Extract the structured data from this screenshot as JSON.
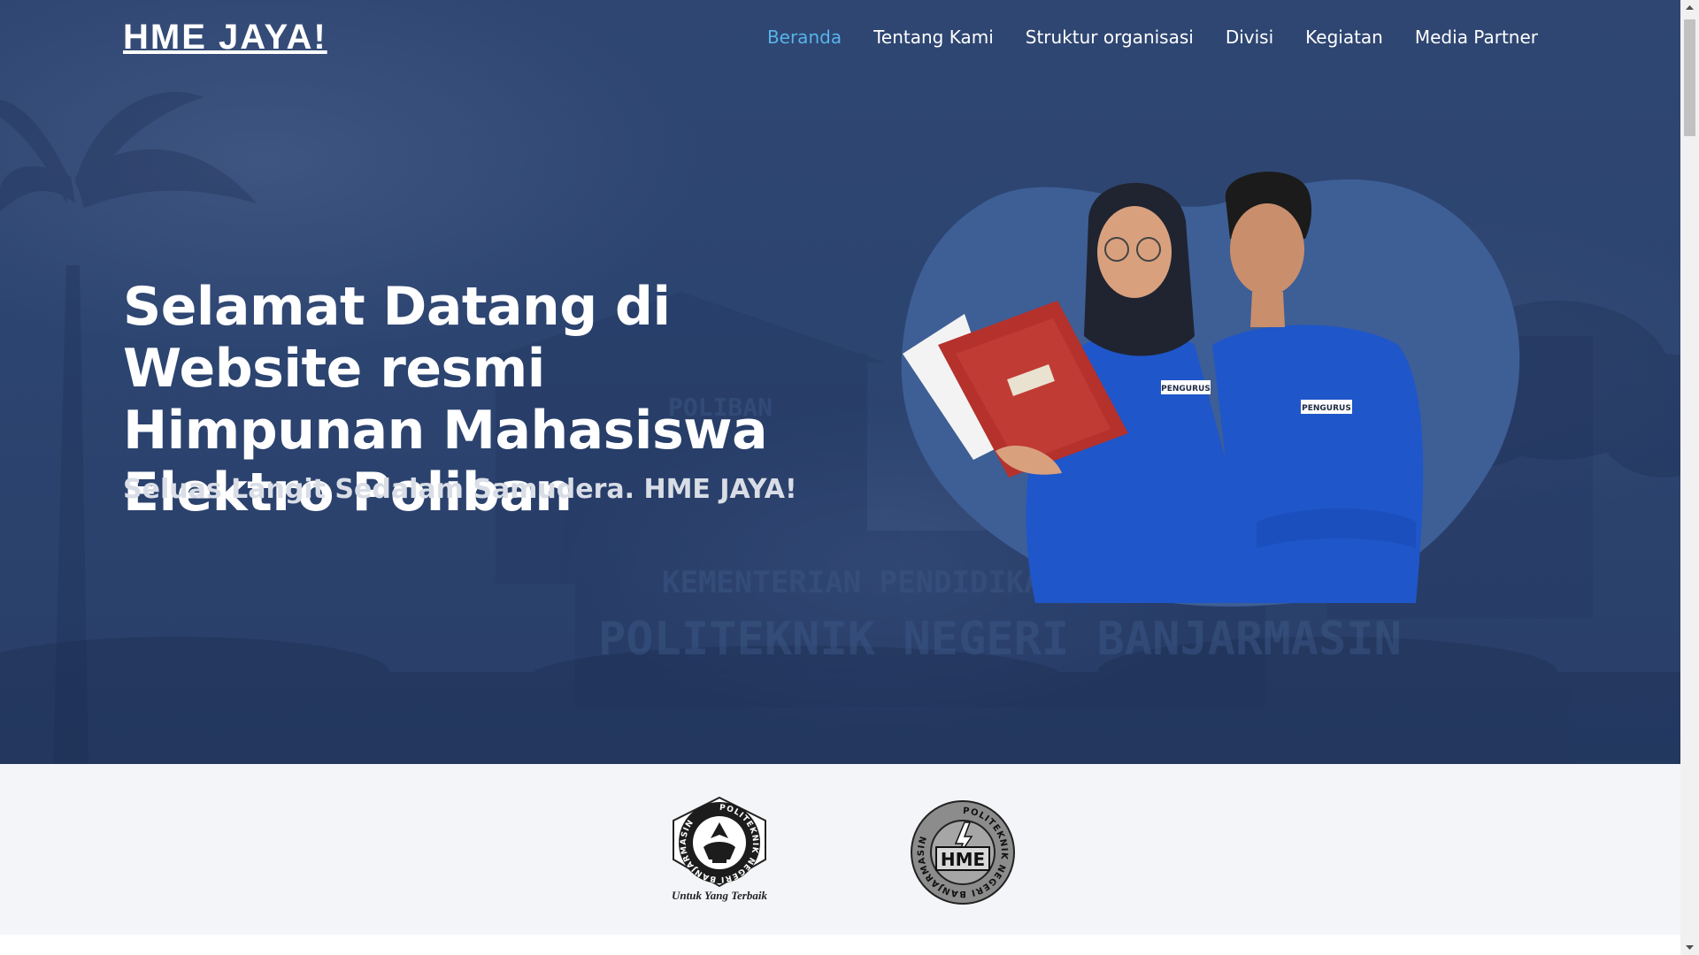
{
  "brand": {
    "name": "HME JAYA!"
  },
  "nav": {
    "items": [
      {
        "label": "Beranda",
        "active": true
      },
      {
        "label": "Tentang Kami",
        "active": false
      },
      {
        "label": "Struktur organisasi",
        "active": false
      },
      {
        "label": "Divisi",
        "active": false
      },
      {
        "label": "Kegiatan",
        "active": false
      },
      {
        "label": "Media Partner",
        "active": false
      }
    ]
  },
  "hero": {
    "title": "Selamat Datang di Website resmi Himpunan Mahasiswa Elektro Poliban",
    "subtitle": "Seluas Langit Sedalam Samudera. HME JAYA!",
    "background_signs": [
      "POLIBAN",
      "KEMENTERIAN PENDIDIKAN DAN KEBUDAYAAN",
      "POLITEKNIK NEGERI BANJARMASIN"
    ],
    "badge_label": "PENGURUS"
  },
  "clients": {
    "logos": [
      {
        "name": "politeknik-negeri-banjarmasin-logo",
        "ring_text": "POLITEKNIK NEGERI BANJARMASIN",
        "tagline": "Untuk Yang Terbaik"
      },
      {
        "name": "hme-logo",
        "ring_text": "POLITEKNIK NEGERI BANJARMASIN",
        "center_text": "HME"
      }
    ]
  },
  "colors": {
    "hero_overlay": "#2c4470",
    "nav_active": "#58b3ea",
    "blob": "#3e5e96",
    "shirt": "#1f56c9",
    "strip_bg": "#f4f5f9"
  },
  "icons": [
    "scroll-up-arrow-icon",
    "scroll-down-arrow-icon"
  ]
}
